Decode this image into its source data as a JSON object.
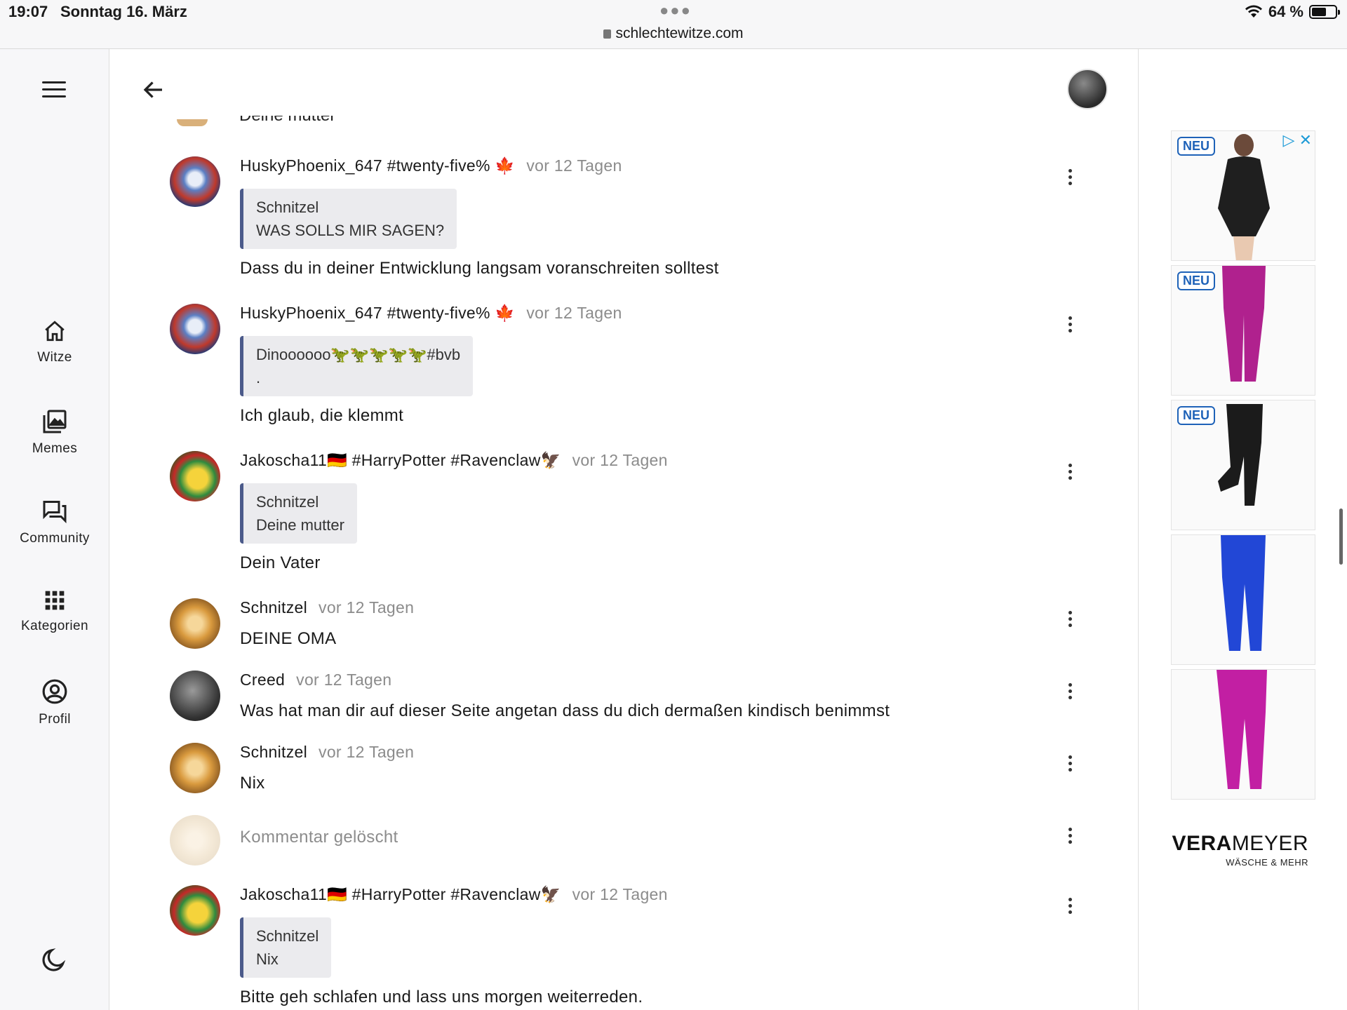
{
  "status_bar": {
    "time": "19:07",
    "date": "Sonntag 16. März",
    "url": "schlechtewitze.com",
    "battery": "64 %",
    "battery_level_percent": 64
  },
  "nav": {
    "items": [
      {
        "label": "Witze",
        "icon": "home-icon"
      },
      {
        "label": "Memes",
        "icon": "gallery-icon"
      },
      {
        "label": "Community",
        "icon": "chat-icon"
      },
      {
        "label": "Kategorien",
        "icon": "grid-icon"
      },
      {
        "label": "Profil",
        "icon": "profile-icon"
      }
    ],
    "theme_icon": "moon-icon"
  },
  "partial_above": "Deine mutter",
  "comments": [
    {
      "author": "HuskyPhoenix_647 #twenty-five% 🍁",
      "time": "vor 12 Tagen",
      "quote_author": "Schnitzel",
      "quote_lines": [
        "WAS SOLLS MIR SAGEN?"
      ],
      "text": "Dass du in deiner Entwicklung langsam voranschreiten solltest",
      "avatar": "husky"
    },
    {
      "author": "HuskyPhoenix_647 #twenty-five% 🍁",
      "time": "vor 12 Tagen",
      "quote_author": "Dinoooooo🦖🦖🦖🦖🦖#bvb",
      "quote_lines": [
        "."
      ],
      "text": "Ich glaub, die klemmt",
      "avatar": "husky"
    },
    {
      "author": "Jakoscha11🇩🇪 #HarryPotter #Ravenclaw🦅",
      "time": "vor 12 Tagen",
      "quote_author": "Schnitzel",
      "quote_lines": [
        "Deine mutter"
      ],
      "text": "Dein Vater",
      "avatar": "jakoscha"
    },
    {
      "author": "Schnitzel",
      "time": "vor 12 Tagen",
      "text": "DEINE OMA",
      "avatar": "schnitzel"
    },
    {
      "author": "Creed",
      "time": "vor 12 Tagen",
      "text": "Was hat man dir auf dieser Seite angetan dass du dich dermaßen kindisch benimmst",
      "avatar": "creed"
    },
    {
      "author": "Schnitzel",
      "time": "vor 12 Tagen",
      "text": "Nix",
      "avatar": "schnitzel"
    },
    {
      "deleted_text": "Kommentar gelöscht",
      "avatar": "deleted"
    },
    {
      "author": "Jakoscha11🇩🇪 #HarryPotter #Ravenclaw🦅",
      "time": "vor 12 Tagen",
      "quote_author": "Schnitzel",
      "quote_lines": [
        "Nix"
      ],
      "text": "Bitte geh schlafen und lass uns morgen weiterreden.",
      "avatar": "jakoscha"
    }
  ],
  "ad": {
    "badges": [
      "NEU",
      "NEU",
      "NEU"
    ],
    "brand_bold": "VERA",
    "brand_rest": "MEYER",
    "brand_sub": "WÄSCHE & MEHR",
    "tile_colors": [
      "#1f1f1f",
      "#b0218e",
      "#1b1b1b",
      "#2247d6",
      "#c21fa3"
    ]
  }
}
